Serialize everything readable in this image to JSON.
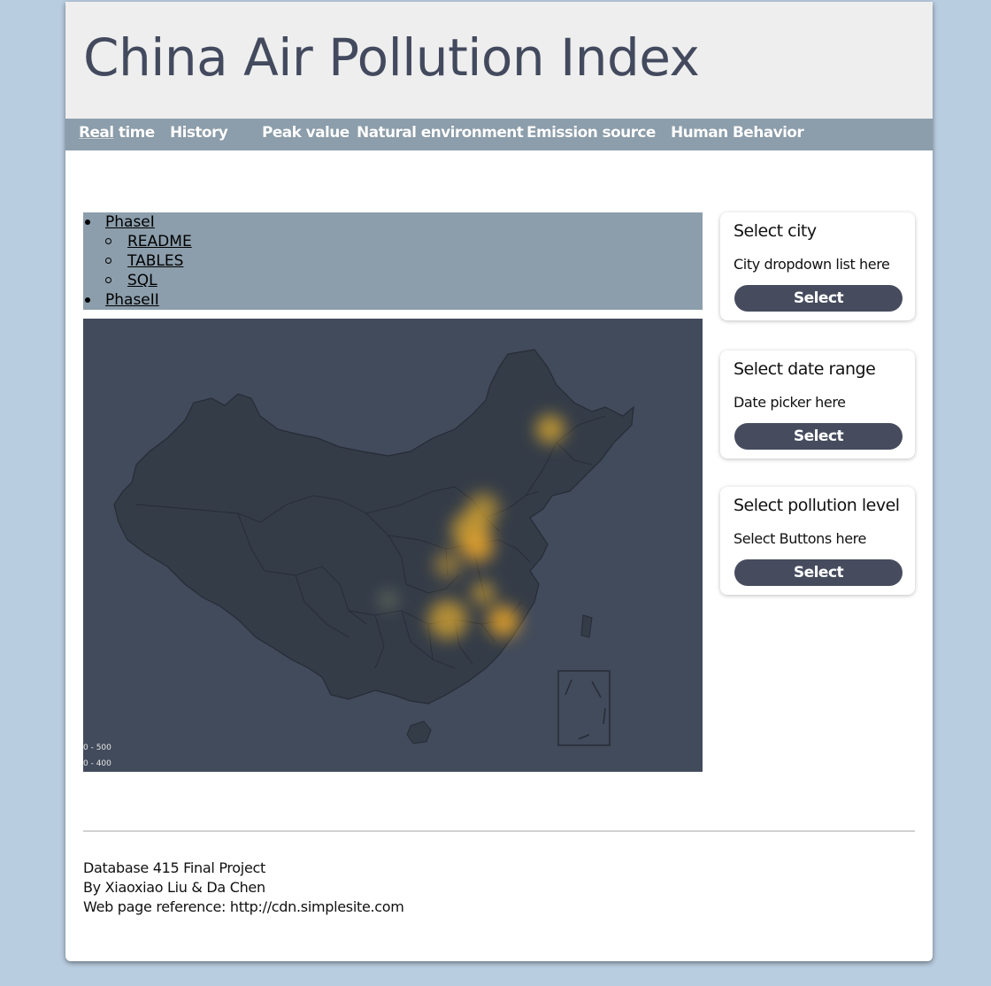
{
  "header": {
    "title": "China Air Pollution Index"
  },
  "nav": {
    "items": [
      {
        "label": "Real time",
        "hl": "Real",
        "rest": " time"
      },
      {
        "label": "History"
      },
      {
        "label": "Peak value"
      },
      {
        "label": "Natural environment"
      },
      {
        "label": "Emission source"
      },
      {
        "label": "Human Behavior"
      }
    ]
  },
  "phase_menu": {
    "phase1": "PhaseI",
    "sub": [
      "README",
      "TABLES",
      "SQL"
    ],
    "phase2": "PhaseII"
  },
  "map": {
    "legend": [
      "0 - 500",
      "0 - 400"
    ],
    "colors": {
      "background": "#424b5b",
      "land": "#343c48",
      "heat": "#e8b12e"
    }
  },
  "cards": [
    {
      "title": "Select city",
      "desc": "City dropdown list here",
      "button": "Select"
    },
    {
      "title": "Select date range",
      "desc": "Date picker here",
      "button": "Select"
    },
    {
      "title": "Select pollution level",
      "desc": "Select Buttons here",
      "button": "Select"
    }
  ],
  "footer": {
    "line1": "Database 415 Final Project",
    "line2": "By Xiaoxiao Liu & Da Chen",
    "line3": "Web page reference: http://cdn.simplesite.com"
  },
  "colors": {
    "page_bg": "#b9cde0",
    "header_bg": "#eeeeee",
    "title": "#434a5e",
    "nav_bg": "#8c9eac",
    "button": "#464c5e"
  }
}
